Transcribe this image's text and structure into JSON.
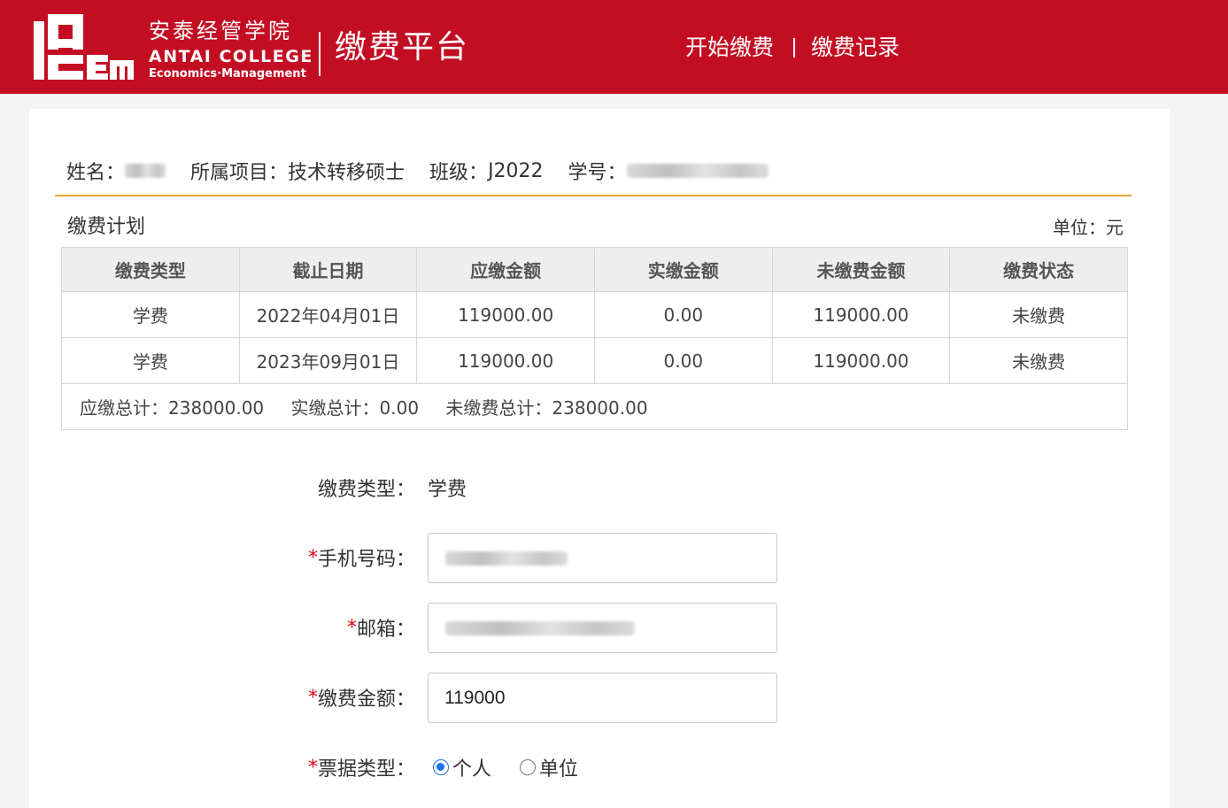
{
  "brand": {
    "name_cn": "安泰经管学院",
    "name_en": "ANTAI COLLEGE",
    "subtitle_en": "Economics·Management",
    "logo_text": "ACEM",
    "platform_title": "缴费平台",
    "color": "#c30d23"
  },
  "nav": {
    "start_payment": "开始缴费",
    "payment_records": "缴费记录"
  },
  "student": {
    "name_label": "姓名：",
    "project_label": "所属项目：",
    "project_value": "技术转移硕士",
    "class_label": "班级：",
    "class_value": "J2022",
    "id_label": "学号："
  },
  "plan": {
    "title": "缴费计划",
    "unit": "单位：元",
    "columns": [
      "缴费类型",
      "截止日期",
      "应缴金额",
      "实缴金额",
      "未缴费金额",
      "缴费状态"
    ],
    "rows": [
      {
        "type": "学费",
        "deadline": "2022年04月01日",
        "due": "119000.00",
        "paid": "0.00",
        "unpaid": "119000.00",
        "status": "未缴费"
      },
      {
        "type": "学费",
        "deadline": "2023年09月01日",
        "due": "119000.00",
        "paid": "0.00",
        "unpaid": "119000.00",
        "status": "未缴费"
      }
    ],
    "totals": {
      "due_label": "应缴总计：",
      "due_value": "238000.00",
      "paid_label": "实缴总计：",
      "paid_value": "0.00",
      "unpaid_label": "未缴费总计：",
      "unpaid_value": "238000.00"
    },
    "status_color": "#e60012"
  },
  "form": {
    "fee_type_label": "缴费类型：",
    "fee_type_value": "学费",
    "required_mark": "*",
    "phone_label": "手机号码：",
    "email_label": "邮箱：",
    "amount_label": "缴费金额：",
    "amount_value": "119000",
    "invoice_label": "票据类型：",
    "invoice_options": [
      "个人",
      "单位"
    ],
    "invoice_selected": "个人"
  }
}
